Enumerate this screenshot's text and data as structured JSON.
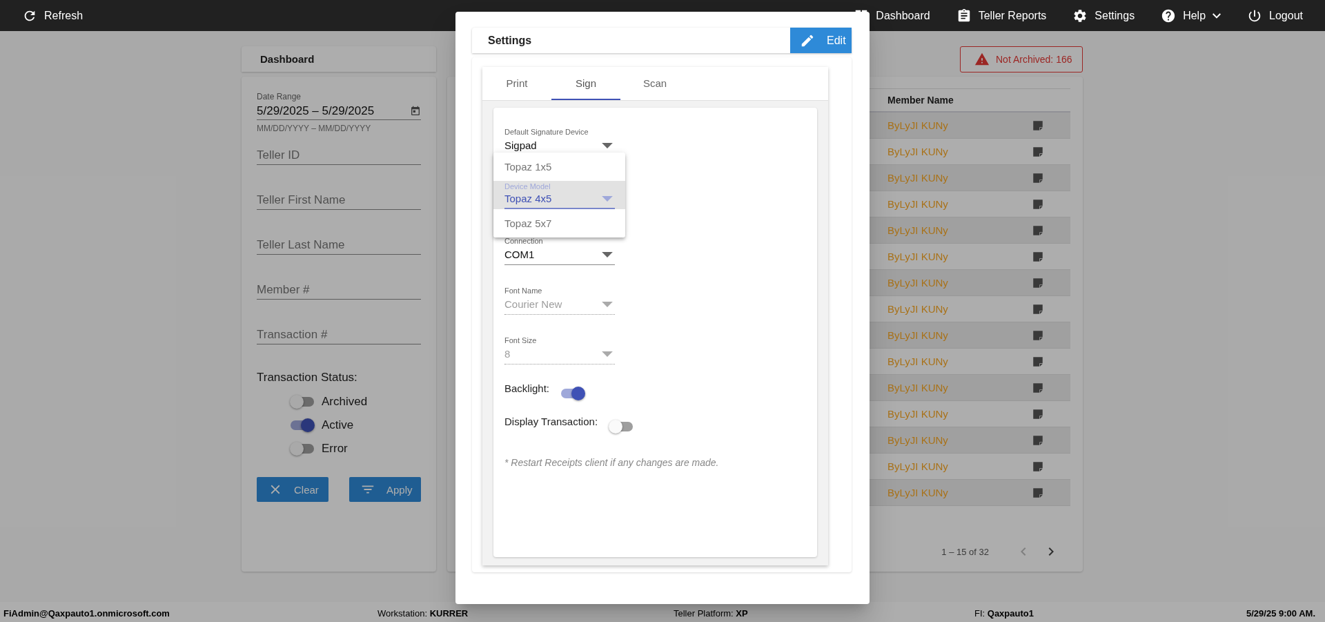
{
  "top_bar": {
    "refresh": "Refresh",
    "nav": [
      {
        "label": "Dashboard"
      },
      {
        "label": "Teller Reports"
      },
      {
        "label": "Settings"
      },
      {
        "label": "Help"
      },
      {
        "label": "Logout"
      }
    ]
  },
  "dashboard_header": "Dashboard",
  "not_archived_badge": "Not Archived: 166",
  "filters": {
    "date_range": {
      "label": "Date Range",
      "value": "5/29/2025 – 5/29/2025",
      "hint": "MM/DD/YYYY – MM/DD/YYYY"
    },
    "fields": [
      {
        "placeholder": "Teller ID"
      },
      {
        "placeholder": "Teller First Name"
      },
      {
        "placeholder": "Teller Last Name"
      },
      {
        "placeholder": "Member #"
      },
      {
        "placeholder": "Transaction #"
      }
    ],
    "status_label": "Transaction Status:",
    "statuses": [
      {
        "label": "Archived",
        "on": false
      },
      {
        "label": "Active",
        "on": true
      },
      {
        "label": "Error",
        "on": false
      }
    ],
    "buttons": [
      "Clear",
      "Apply"
    ]
  },
  "table": {
    "columns": [
      "Member Name"
    ],
    "rows": [
      {
        "member_name": "ByLyJI KUNy"
      },
      {
        "member_name": "ByLyJI KUNy"
      },
      {
        "member_name": "ByLyJI KUNy"
      },
      {
        "member_name": "ByLyJI KUNy"
      },
      {
        "member_name": "ByLyJI KUNy"
      },
      {
        "member_name": "ByLyJI KUNy"
      },
      {
        "member_name": "ByLyJI KUNy"
      },
      {
        "member_name": "ByLyJI KUNy"
      },
      {
        "member_name": "ByLyJI KUNy"
      },
      {
        "member_name": "ByLyJI KUNy"
      },
      {
        "member_name": "ByLyJI KUNy"
      },
      {
        "member_name": "ByLyJI KUNy"
      },
      {
        "member_name": "ByLyJI KUNy"
      },
      {
        "member_name": "ByLyJI KUNy"
      },
      {
        "member_name": "ByLyJI KUNy"
      }
    ],
    "paginator": "1 – 15 of 32"
  },
  "dialog": {
    "title": "Settings",
    "edit_button": "Edit",
    "tabs": [
      {
        "label": "Print",
        "selected": false
      },
      {
        "label": "Sign",
        "selected": true
      },
      {
        "label": "Scan",
        "selected": false
      }
    ],
    "fields": [
      {
        "kind": "select",
        "label": "Default Signature Device",
        "value": "Sigpad",
        "disabled": false
      },
      {
        "kind": "open-select",
        "label": "Device Model",
        "options": [
          {
            "label": "Topaz 1x5",
            "selected": false
          },
          {
            "label": "Topaz 4x5",
            "selected": true
          },
          {
            "label": "Topaz 5x7",
            "selected": false
          }
        ]
      },
      {
        "kind": "select",
        "label": "Connection",
        "value": "COM1",
        "disabled": false
      },
      {
        "kind": "select",
        "label": "Font Name",
        "value": "Courier New",
        "disabled": true
      },
      {
        "kind": "select",
        "label": "Font Size",
        "value": "8",
        "disabled": true
      }
    ],
    "toggles": [
      {
        "label": "Backlight:",
        "on": true
      },
      {
        "label": "Display Transaction:",
        "on": false
      }
    ],
    "note": "* Restart Receipts client if any changes are made."
  },
  "status_bar": [
    {
      "value": "FiAdmin@Qaxpauto1.onmicrosoft.com"
    },
    {
      "label": "Workstation:",
      "value": "KURRER"
    },
    {
      "label": "Teller Platform:",
      "value": "XP"
    },
    {
      "label": "FI:",
      "value": "Qaxpauto1"
    },
    {
      "value": "5/29/25 9:00 AM."
    }
  ]
}
